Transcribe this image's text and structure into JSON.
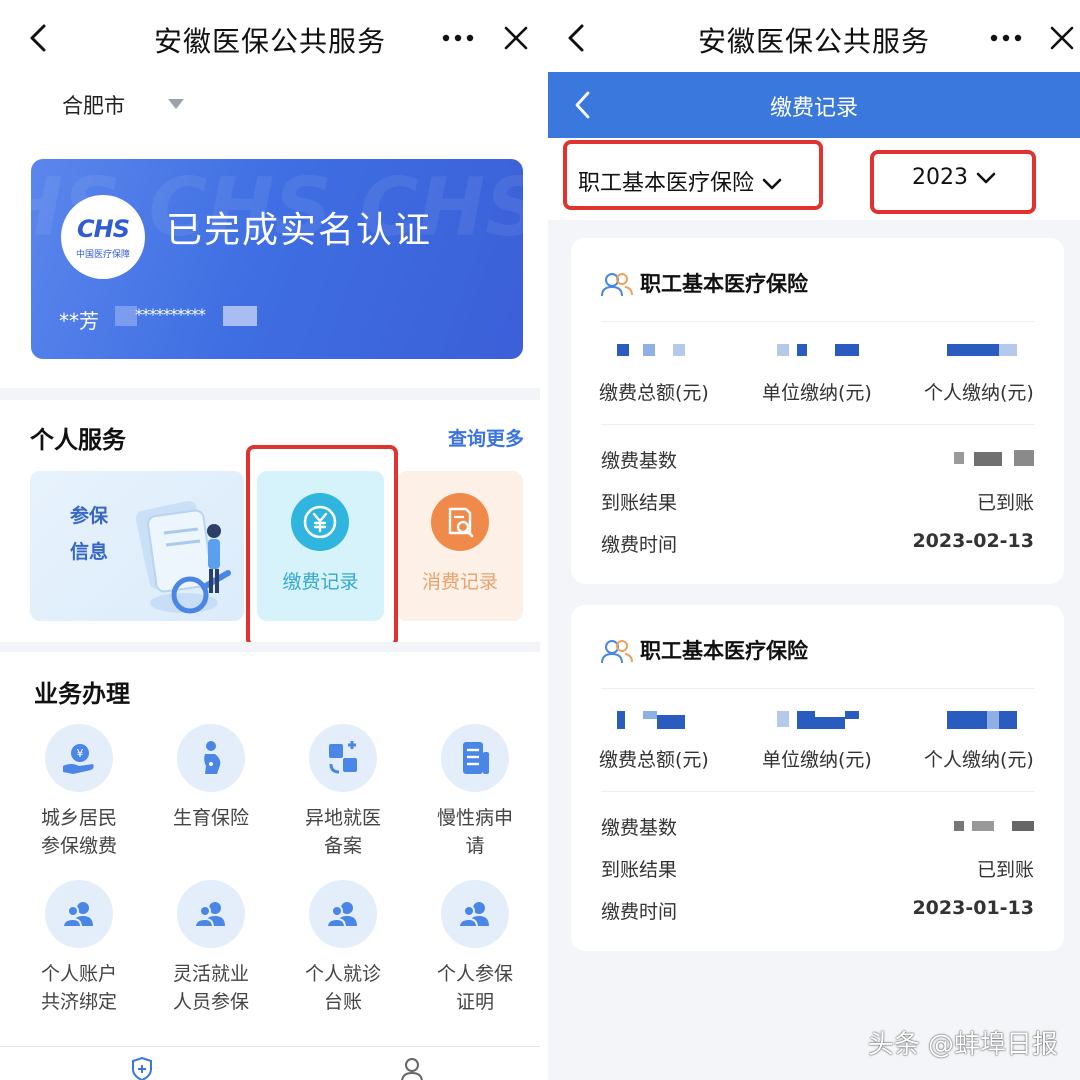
{
  "left": {
    "topbar": {
      "title": "安徽医保公共服务"
    },
    "city": "合肥市",
    "card": {
      "watermark": "CHS CHS CHS",
      "logo_main": "CHS",
      "logo_sub": "中国医疗保障",
      "status": "已完成实名认证",
      "masked_name": "**芳",
      "masked_id": "**********"
    },
    "personal": {
      "title": "个人服务",
      "more": "查询更多",
      "insurance_label_1": "参保",
      "insurance_label_2": "信息",
      "pay_label": "缴费记录",
      "consume_label": "消费记录"
    },
    "business": {
      "title": "业务办理",
      "items": [
        {
          "l1": "城乡居民",
          "l2": "参保缴费",
          "icon": "hand-coin-icon"
        },
        {
          "l1": "生育保险",
          "l2": "",
          "icon": "pregnant-icon"
        },
        {
          "l1": "异地就医",
          "l2": "备案",
          "icon": "relocate-medical-icon"
        },
        {
          "l1": "慢性病申",
          "l2": "请",
          "icon": "document-list-icon"
        },
        {
          "l1": "个人账户",
          "l2": "共济绑定",
          "icon": "users-icon"
        },
        {
          "l1": "灵活就业",
          "l2": "人员参保",
          "icon": "users-icon"
        },
        {
          "l1": "个人就诊",
          "l2": "台账",
          "icon": "users-icon"
        },
        {
          "l1": "个人参保",
          "l2": "证明",
          "icon": "users-icon"
        }
      ]
    }
  },
  "right": {
    "topbar": {
      "title": "安徽医保公共服务"
    },
    "nav_title": "缴费记录",
    "filter_type": "职工基本医疗保险",
    "filter_year": "2023",
    "col_labels": [
      "缴费总额(元)",
      "单位缴纳(元)",
      "个人缴纳(元)"
    ],
    "row_labels": [
      "缴费基数",
      "到账结果",
      "缴费时间"
    ],
    "records": [
      {
        "title": "职工基本医疗保险",
        "result": "已到账",
        "date": "2023-02-13"
      },
      {
        "title": "职工基本医疗保险",
        "result": "已到账",
        "date": "2023-01-13"
      }
    ]
  },
  "watermark": "头条 @蚌埠日报",
  "colors": {
    "primary": "#3a78dd",
    "highlight": "#e0322f",
    "pay_icon": "#2fb5de",
    "consume_icon": "#f08a4b"
  }
}
